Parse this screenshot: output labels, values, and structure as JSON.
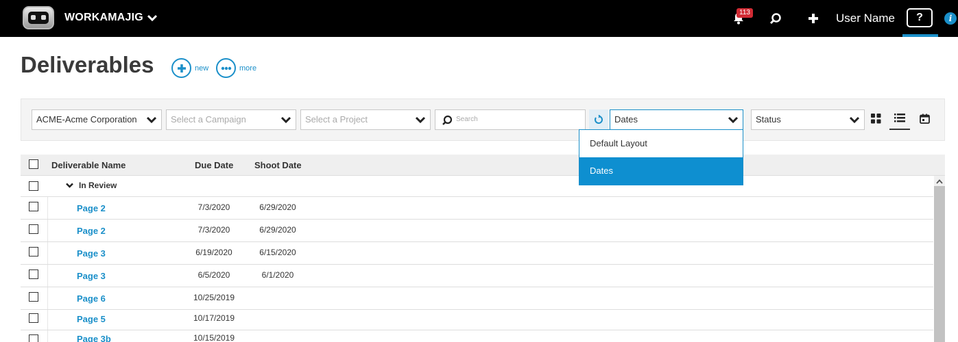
{
  "topbar": {
    "brand": "WORKAMAJIG",
    "notification_count": "113",
    "username": "User Name",
    "help_label": "?",
    "info_label": "i"
  },
  "page": {
    "title": "Deliverables",
    "new_label": "new",
    "more_label": "more"
  },
  "filters": {
    "company": "ACME-Acme Corporation",
    "campaign_placeholder": "Select a Campaign",
    "project_placeholder": "Select a Project",
    "search_placeholder": "Search",
    "layout": "Dates",
    "status": "Status"
  },
  "layout_dropdown": {
    "options": [
      "Default Layout",
      "Dates"
    ],
    "selected": "Dates"
  },
  "table": {
    "columns": [
      "Deliverable Name",
      "Due Date",
      "Shoot Date"
    ],
    "group": "In Review",
    "rows": [
      {
        "name": "Page 2",
        "due": "7/3/2020",
        "shoot": "6/29/2020"
      },
      {
        "name": "Page 2",
        "due": "7/3/2020",
        "shoot": "6/29/2020"
      },
      {
        "name": "Page 3",
        "due": "6/19/2020",
        "shoot": "6/15/2020"
      },
      {
        "name": "Page 3",
        "due": "6/5/2020",
        "shoot": "6/1/2020"
      },
      {
        "name": "Page 6",
        "due": "10/25/2019",
        "shoot": ""
      },
      {
        "name": "Page 5",
        "due": "10/17/2019",
        "shoot": ""
      },
      {
        "name": "Page 3b",
        "due": "10/15/2019",
        "shoot": ""
      }
    ]
  },
  "colors": {
    "accent": "#1a8fc9",
    "topbar": "#000000",
    "badge": "#d12b34"
  }
}
